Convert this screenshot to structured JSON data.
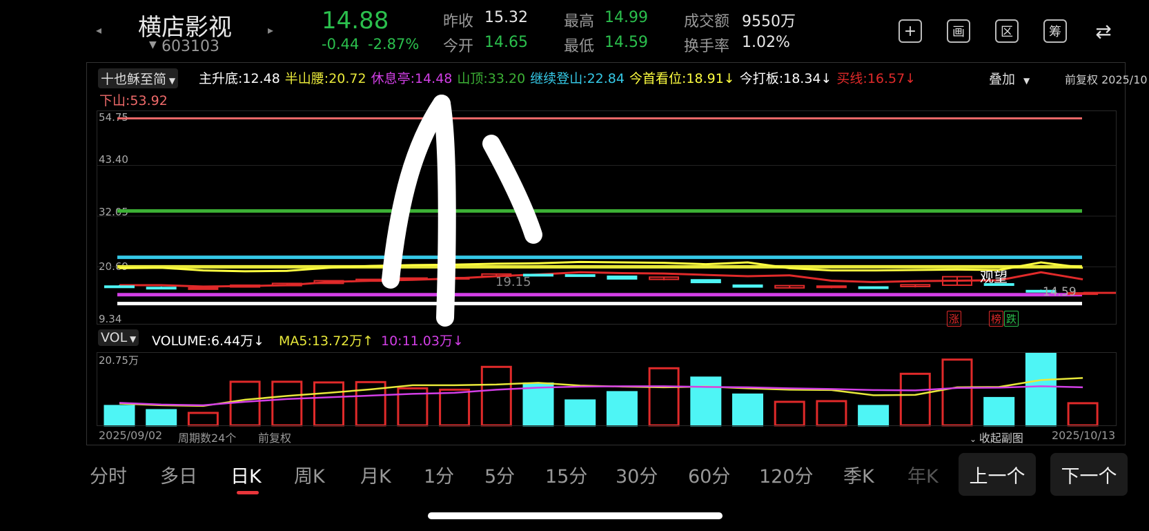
{
  "header": {
    "stock_name": "横店影视",
    "stock_code": "603103",
    "price": "14.88",
    "change": "-0.44",
    "change_pct": "-2.87%",
    "quotes": [
      {
        "label": "昨收",
        "value": "15.32",
        "color": "#e8e8e8"
      },
      {
        "label": "今开",
        "value": "14.65",
        "color": "#2bbf4d"
      },
      {
        "label": "最高",
        "value": "14.99",
        "color": "#2bbf4d"
      },
      {
        "label": "最低",
        "value": "14.59",
        "color": "#2bbf4d"
      },
      {
        "label": "成交额",
        "value": "9550万",
        "color": "#e8e8e8"
      },
      {
        "label": "换手率",
        "value": "1.02%",
        "color": "#e8e8e8"
      }
    ],
    "toolbar_icons": [
      "plus-icon",
      "picture-icon",
      "range-icon",
      "chips-icon",
      "switch-icon"
    ],
    "toolbar_glyphs": [
      "+",
      "画",
      "区",
      "筹",
      "⇄"
    ]
  },
  "indicator_bar": {
    "selector": "十也稣至简",
    "items": [
      {
        "label": "主升底",
        "value": "12.48",
        "color": "#ffffff"
      },
      {
        "label": "半山腰",
        "value": "20.72",
        "color": "#e8e83a"
      },
      {
        "label": "休息亭",
        "value": "14.48",
        "color": "#d23fe6"
      },
      {
        "label": "山顶",
        "value": "33.20",
        "color": "#3cb035"
      },
      {
        "label": "继续登山",
        "value": "22.84",
        "color": "#35c8e6"
      },
      {
        "label": "今首看位",
        "value": "18.91↓",
        "color": "#ffff40"
      },
      {
        "label": "今打板",
        "value": "18.34↓",
        "color": "#ffffff"
      },
      {
        "label": "买线",
        "value": "16.57↓",
        "color": "#e02a2a"
      }
    ],
    "second_line": {
      "label": "下山",
      "value": "53.92",
      "color": "#f06a6a"
    },
    "overlay": "叠加",
    "right_text": "前复权 2025/10"
  },
  "price_axis": [
    "54.75",
    "43.40",
    "32.05",
    "20.69",
    "9.34"
  ],
  "chart_annotations": {
    "mid_price": "19.15",
    "last_price": "14.59",
    "watch_label": "观望",
    "tag_up": "涨",
    "tag_list": "榜",
    "tag_down": "跌"
  },
  "volume_bar": {
    "selector": "VOL",
    "volume": "VOLUME:6.44万↓",
    "ma5": "MA5:13.72万↑",
    "ma10": "10:11.03万↓",
    "axis_top": "20.75万"
  },
  "footer": {
    "start_date": "2025/09/02",
    "period_count": "周期数24个",
    "adjust": "前复权",
    "collapse": "收起副图",
    "end_date": "2025/10/13"
  },
  "tabs": [
    "分时",
    "多日",
    "日K",
    "周K",
    "月K",
    "1分",
    "5分",
    "15分",
    "30分",
    "60分",
    "120分",
    "季K",
    "年K"
  ],
  "active_tab": "日K",
  "prev_button": "上一个",
  "next_button": "下一个",
  "colors": {
    "up": "#e02a2a",
    "down": "#4ef5f5",
    "ma5": "#e8e83a",
    "ma10": "#d23fe6"
  },
  "chart_data": {
    "type": "candlestick",
    "ylim": [
      9.34,
      54.75
    ],
    "horizontal_levels": [
      {
        "name": "下山",
        "value": 53.92,
        "color": "#f06a6a"
      },
      {
        "name": "山顶",
        "value": 33.2,
        "color": "#3cb035"
      },
      {
        "name": "继续登山",
        "value": 22.84,
        "color": "#35c8e6"
      },
      {
        "name": "半山腰",
        "value": 20.72,
        "color": "#e8e83a"
      },
      {
        "name": "休息亭",
        "value": 14.48,
        "color": "#d23fe6"
      },
      {
        "name": "主升底",
        "value": 12.48,
        "color": "#ffffff"
      }
    ],
    "candles": [
      {
        "o": 16.4,
        "c": 16.2,
        "h": 16.6,
        "l": 16.0
      },
      {
        "o": 16.1,
        "c": 15.9,
        "h": 16.3,
        "l": 15.8
      },
      {
        "o": 15.8,
        "c": 16.0,
        "h": 16.1,
        "l": 15.7
      },
      {
        "o": 16.2,
        "c": 16.6,
        "h": 16.7,
        "l": 16.1
      },
      {
        "o": 16.5,
        "c": 17.0,
        "h": 17.1,
        "l": 16.4
      },
      {
        "o": 17.0,
        "c": 17.6,
        "h": 17.7,
        "l": 16.9
      },
      {
        "o": 17.5,
        "c": 17.9,
        "h": 18.0,
        "l": 17.4
      },
      {
        "o": 17.9,
        "c": 18.2,
        "h": 18.3,
        "l": 17.6
      },
      {
        "o": 18.0,
        "c": 18.3,
        "h": 18.4,
        "l": 17.9
      },
      {
        "o": 18.6,
        "c": 19.1,
        "h": 19.2,
        "l": 18.5
      },
      {
        "o": 19.0,
        "c": 18.9,
        "h": 19.1,
        "l": 18.7
      },
      {
        "o": 18.9,
        "c": 18.7,
        "h": 19.0,
        "l": 18.6
      },
      {
        "o": 18.6,
        "c": 18.0,
        "h": 18.7,
        "l": 17.9
      },
      {
        "o": 17.9,
        "c": 18.4,
        "h": 18.5,
        "l": 17.7
      },
      {
        "o": 17.8,
        "c": 17.2,
        "h": 17.9,
        "l": 17.1
      },
      {
        "o": 16.6,
        "c": 16.2,
        "h": 16.7,
        "l": 16.1
      },
      {
        "o": 16.0,
        "c": 16.5,
        "h": 16.6,
        "l": 15.9
      },
      {
        "o": 16.1,
        "c": 16.4,
        "h": 16.5,
        "l": 15.9
      },
      {
        "o": 16.2,
        "c": 16.1,
        "h": 16.3,
        "l": 16.0
      },
      {
        "o": 16.3,
        "c": 16.7,
        "h": 16.8,
        "l": 16.1
      },
      {
        "o": 16.6,
        "c": 18.5,
        "h": 18.6,
        "l": 16.5
      },
      {
        "o": 16.9,
        "c": 16.8,
        "h": 17.0,
        "l": 16.7
      },
      {
        "o": 15.4,
        "c": 15.3,
        "h": 15.6,
        "l": 15.1
      },
      {
        "o": 14.65,
        "c": 14.88,
        "h": 14.99,
        "l": 14.59
      }
    ],
    "line_today_watch": [
      20.4,
      20.5,
      19.9,
      19.7,
      19.8,
      20.5,
      20.9,
      21.1,
      21.2,
      21.4,
      21.5,
      21.8,
      21.7,
      21.6,
      21.3,
      21.7,
      20.4,
      19.9,
      19.9,
      20.0,
      20.1,
      20.0,
      21.7,
      20.5
    ],
    "line_buy": [
      16.6,
      16.6,
      16.3,
      16.4,
      16.6,
      17.3,
      17.6,
      17.8,
      18.1,
      18.6,
      19.0,
      19.5,
      19.3,
      19.2,
      18.9,
      18.6,
      18.8,
      17.6,
      17.3,
      17.5,
      17.6,
      17.7,
      19.5,
      17.9
    ],
    "volume_ylim": [
      0,
      20.75
    ],
    "volume": [
      5.6,
      4.4,
      3.6,
      12.6,
      12.6,
      12.4,
      12.5,
      10.7,
      10.3,
      16.9,
      12.1,
      7.2,
      9.6,
      16.5,
      13.8,
      8.9,
      6.8,
      7.0,
      5.6,
      14.9,
      19.0,
      7.9,
      20.7,
      6.4
    ],
    "volume_up": [
      false,
      false,
      true,
      true,
      true,
      true,
      true,
      true,
      true,
      true,
      false,
      false,
      false,
      true,
      false,
      false,
      true,
      true,
      false,
      true,
      true,
      false,
      false,
      true
    ],
    "ma5": [
      6.3,
      5.8,
      5.6,
      7.4,
      8.5,
      9.4,
      10.4,
      11.6,
      11.6,
      11.8,
      12.3,
      11.5,
      11.2,
      11.0,
      11.2,
      10.7,
      10.3,
      10.2,
      8.7,
      8.8,
      11.0,
      11.1,
      13.1,
      13.7
    ],
    "ma10": [
      6.5,
      6.0,
      5.8,
      6.8,
      7.6,
      8.1,
      8.6,
      9.1,
      9.4,
      10.3,
      10.9,
      11.2,
      11.3,
      11.3,
      11.1,
      11.0,
      10.7,
      10.5,
      10.2,
      10.1,
      10.8,
      10.9,
      11.3,
      11.0
    ]
  }
}
